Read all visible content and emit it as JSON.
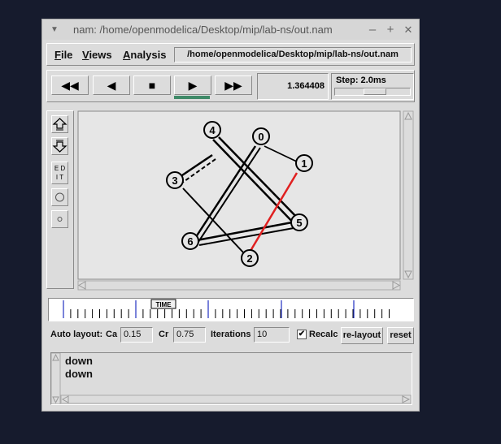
{
  "window": {
    "menu_glyph": "▼",
    "title": "nam: /home/openmodelica/Desktop/mip/lab-ns/out.nam",
    "minimize": "–",
    "maximize": "+",
    "close": "✕"
  },
  "menubar": {
    "file_first": "F",
    "file_rest": "ile",
    "views_first": "V",
    "views_rest": "iews",
    "analysis_first": "A",
    "analysis_rest": "nalysis",
    "path": "/home/openmodelica/Desktop/mip/lab-ns/out.nam"
  },
  "controls": {
    "rewind": "◀◀",
    "back": "◀",
    "stop": "■",
    "play": "▶",
    "fast_forward": "▶▶",
    "current_time": "1.364408",
    "step_label": "Step: 2.0ms",
    "step_level": 0.55
  },
  "sidebar": {
    "edit_label_1": "E D",
    "edit_label_2": "I T"
  },
  "network": {
    "nodes": [
      "0",
      "1",
      "2",
      "3",
      "4",
      "5",
      "6"
    ],
    "link_highlight_color": "#e02020"
  },
  "timeline": {
    "marker_label": "TIME"
  },
  "layout": {
    "auto_layout_label": "Auto layout:",
    "ca_label": "Ca",
    "ca_value": "0.15",
    "cr_label": "Cr",
    "cr_value": "0.75",
    "iterations_label": "Iterations",
    "iterations_value": "10",
    "recalc_label": "Recalc",
    "recalc_checked": true,
    "relayout_label": "re-layout",
    "reset_label": "reset"
  },
  "messages": [
    "down",
    "down"
  ]
}
